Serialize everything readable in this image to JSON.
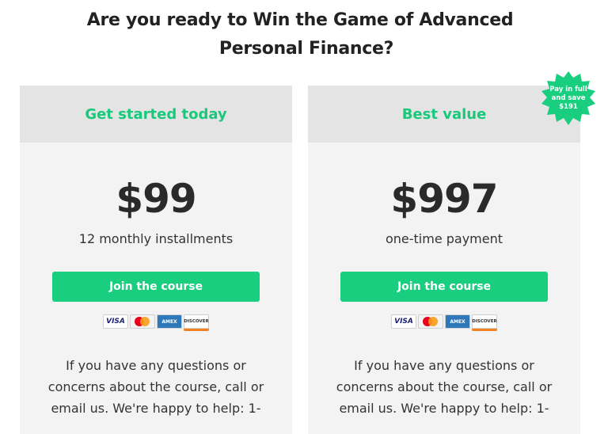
{
  "headline": {
    "line1": "Are you ready to Win the Game of Advanced",
    "line2": "Personal Finance?"
  },
  "plans": [
    {
      "title": "Get started today",
      "price": "$99",
      "price_note": "12 monthly installments",
      "button_label": "Join the course",
      "help_text": "If you have any questions or concerns about the course, call or email us. We're happy to help: 1-"
    },
    {
      "title": "Best value",
      "price": "$997",
      "price_note": "one-time payment",
      "button_label": "Join the course",
      "help_text": "If you have any questions or concerns about the course, call or email us. We're happy to help: 1-"
    }
  ],
  "badge": {
    "line1": "Pay in full",
    "line2": "and save",
    "line3": "$191"
  },
  "payment_icons": {
    "visa": "VISA",
    "mastercard": "mastercard-icon",
    "amex": "AMERICAN EXPRESS",
    "discover": "DISCOVER"
  },
  "colors": {
    "accent": "#19cf7f",
    "title_green": "#19c87b",
    "card_bg": "#f3f3f3",
    "card_head_bg": "#e4e4e4"
  }
}
